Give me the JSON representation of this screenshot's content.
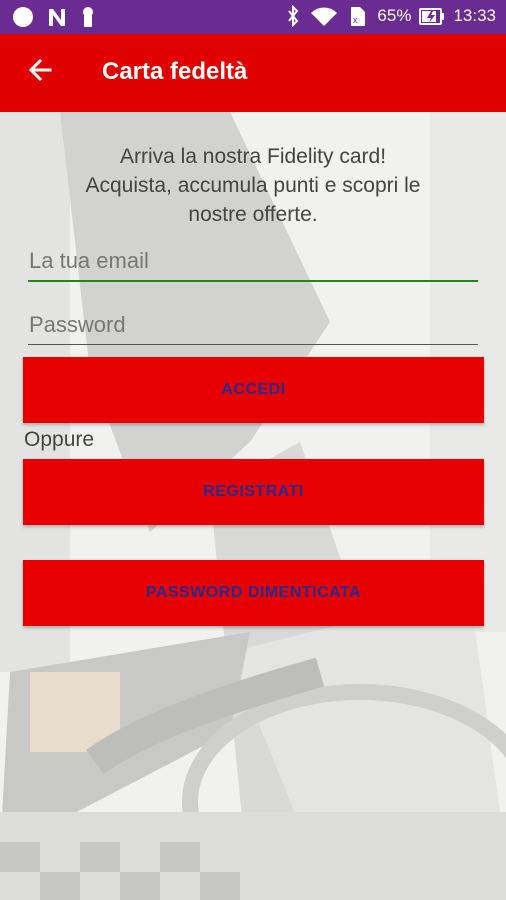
{
  "status_bar": {
    "battery": "65%",
    "time": "13:33"
  },
  "header": {
    "title": "Carta fedeltà"
  },
  "intro": {
    "line1": "Arriva la nostra Fidelity card!",
    "line2": "Acquista, accumula punti e scopri le",
    "line3": "nostre offerte."
  },
  "form": {
    "email_placeholder": "La tua email",
    "email_value": "",
    "password_placeholder": "Password",
    "password_value": ""
  },
  "buttons": {
    "login": "ACCEDI",
    "register": "REGISTRATI",
    "forgot": "PASSWORD DIMENTICATA"
  },
  "separator": "Oppure",
  "colors": {
    "status_bar": "#6a2c92",
    "app_bar": "#e00000",
    "button_bg": "#e60000",
    "button_text": "#2a2a8c",
    "email_underline_focused": "#1a8a1a"
  }
}
